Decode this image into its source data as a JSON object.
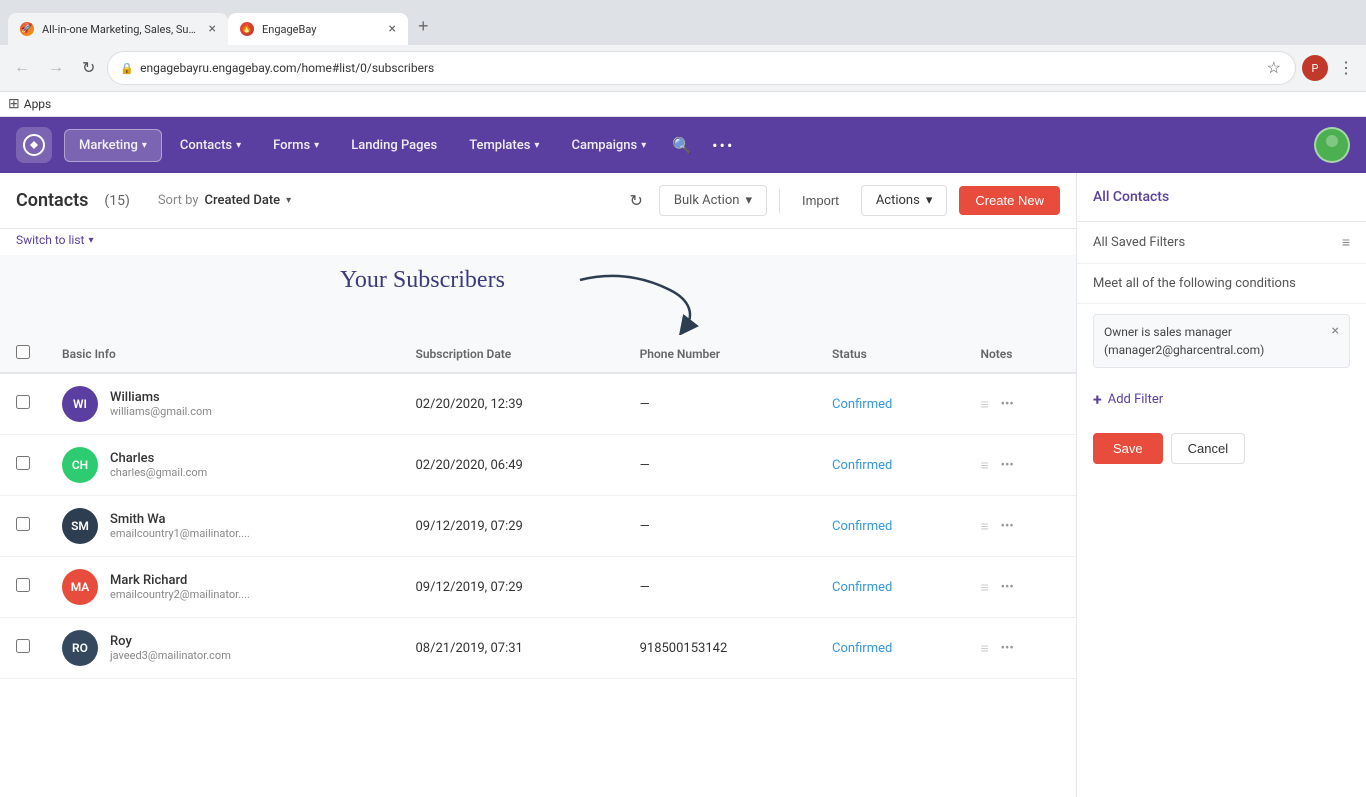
{
  "browser": {
    "tabs": [
      {
        "id": "tab1",
        "favicon": "🚀",
        "title": "All-in-one Marketing, Sales, Supp",
        "active": false,
        "url": ""
      },
      {
        "id": "tab2",
        "favicon": "🔥",
        "title": "EngageBay",
        "active": true,
        "url": "engagebayru.engagebay.com/home#list/0/subscribers"
      }
    ],
    "address": "engagebayru.engagebay.com/home#list/0/subscribers",
    "apps_label": "Apps"
  },
  "nav": {
    "logo_icon": "⚡",
    "items": [
      {
        "label": "Marketing",
        "has_dropdown": true,
        "active": true
      },
      {
        "label": "Contacts",
        "has_dropdown": true,
        "active": false
      },
      {
        "label": "Forms",
        "has_dropdown": true,
        "active": false
      },
      {
        "label": "Landing Pages",
        "has_dropdown": false,
        "active": false
      },
      {
        "label": "Templates",
        "has_dropdown": true,
        "active": false
      },
      {
        "label": "Campaigns",
        "has_dropdown": true,
        "active": false
      }
    ],
    "more_icon": "•••"
  },
  "toolbar": {
    "title": "Contacts",
    "count": "(15)",
    "sort_label": "Sort by",
    "sort_value": "Created Date",
    "bulk_action_label": "Bulk Action",
    "import_label": "Import",
    "actions_label": "Actions",
    "create_new_label": "Create New",
    "switch_to_list": "Switch to list",
    "refresh_title": "Refresh"
  },
  "annotation": {
    "text": "Your Subscribers"
  },
  "table": {
    "headers": [
      "Basic Info",
      "Subscription Date",
      "Phone Number",
      "Status",
      "Notes"
    ],
    "rows": [
      {
        "initials": "WI",
        "avatar_color": "#5b3fa0",
        "name": "Williams",
        "email": "williams@gmail.com",
        "subscription_date": "02/20/2020, 12:39",
        "phone": "—",
        "status": "Confirmed",
        "notes": ""
      },
      {
        "initials": "CH",
        "avatar_color": "#2ecc71",
        "name": "Charles",
        "email": "charles@gmail.com",
        "subscription_date": "02/20/2020, 06:49",
        "phone": "—",
        "status": "Confirmed",
        "notes": ""
      },
      {
        "initials": "SM",
        "avatar_color": "#2c3e50",
        "name": "Smith Wa",
        "email": "emailcountry1@mailinator....",
        "subscription_date": "09/12/2019, 07:29",
        "phone": "—",
        "status": "Confirmed",
        "notes": ""
      },
      {
        "initials": "MA",
        "avatar_color": "#e74c3c",
        "name": "Mark Richard",
        "email": "emailcountry2@mailinator....",
        "subscription_date": "09/12/2019, 07:29",
        "phone": "—",
        "status": "Confirmed",
        "notes": ""
      },
      {
        "initials": "RO",
        "avatar_color": "#34495e",
        "name": "Roy",
        "email": "javeed3@mailinator.com",
        "subscription_date": "08/21/2019, 07:31",
        "phone": "918500153142",
        "status": "Confirmed",
        "notes": ""
      }
    ]
  },
  "sidebar": {
    "all_contacts_label": "All Contacts",
    "saved_filters_label": "All Saved Filters",
    "meet_conditions_label": "Meet all of the following conditions",
    "filter_text": "Owner is sales manager\n(manager2@gharcentral.com)",
    "add_filter_label": "Add Filter",
    "save_label": "Save",
    "cancel_label": "Cancel"
  }
}
